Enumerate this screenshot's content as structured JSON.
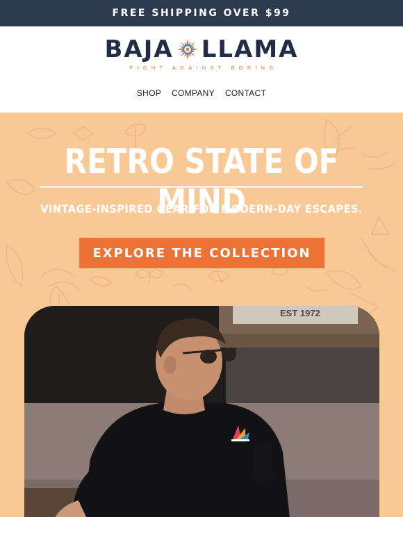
{
  "announcement": {
    "text": "FREE SHIPPING OVER $99"
  },
  "brand": {
    "word_left": "BAJA",
    "word_right": "LLAMA",
    "tagline": "FIGHT AGAINST BORING",
    "icon": "sun-icon",
    "colors": {
      "navy": "#1f2d45",
      "orange": "#e8742e"
    }
  },
  "nav": {
    "items": [
      {
        "label": "SHOP"
      },
      {
        "label": "COMPANY"
      },
      {
        "label": "CONTACT"
      }
    ]
  },
  "hero": {
    "background": "#f9c995",
    "title": "RETRO STATE OF MIND",
    "subtitle": "VINTAGE-INSPIRED GEAR FOR MODERN-DAY ESCAPES.",
    "cta_label": "EXPLORE THE COLLECTION",
    "cta_color": "#ed7235",
    "photo": {
      "description_icon": "model-photo",
      "sign_text": "EST 1972"
    }
  }
}
